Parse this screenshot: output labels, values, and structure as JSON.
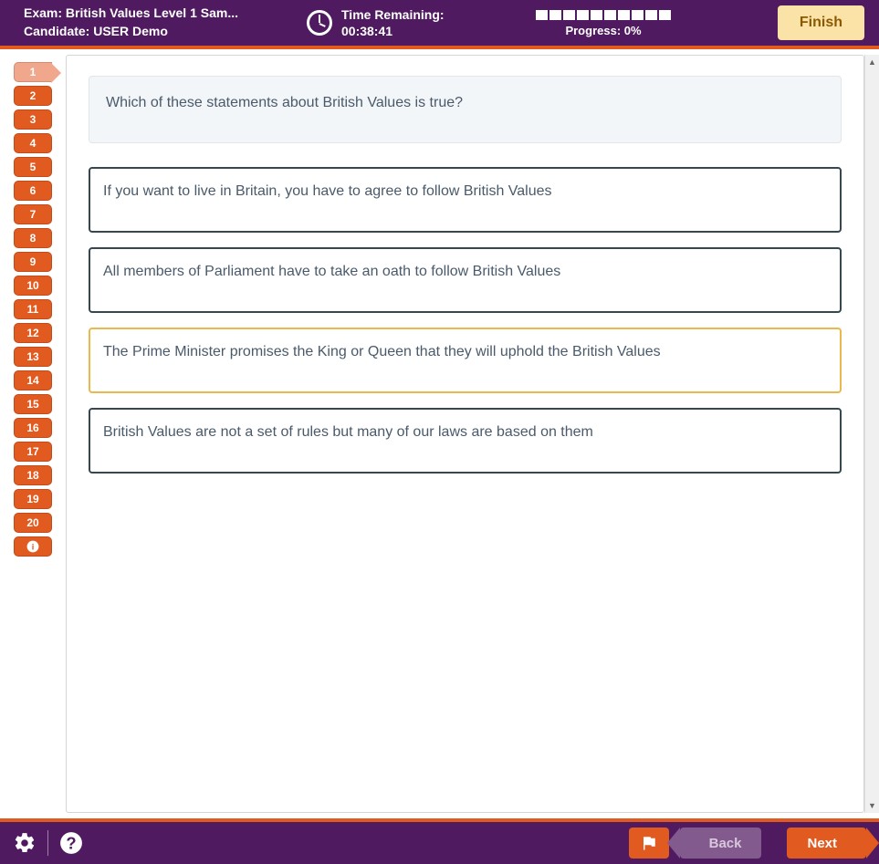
{
  "header": {
    "exam_label": "Exam: British Values Level 1 Sam...",
    "candidate_label": "Candidate: USER Demo",
    "time_title": "Time Remaining:",
    "time_value": "00:38:41",
    "progress_text": "Progress: 0%",
    "progress_segments": 10,
    "finish_label": "Finish"
  },
  "sidebar": {
    "questions": [
      "1",
      "2",
      "3",
      "4",
      "5",
      "6",
      "7",
      "8",
      "9",
      "10",
      "11",
      "12",
      "13",
      "14",
      "15",
      "16",
      "17",
      "18",
      "19",
      "20"
    ],
    "current_index": 0,
    "info_icon": "i"
  },
  "question": {
    "text": "Which of these statements about British Values is true?",
    "answers": [
      "If you want to live in Britain, you have to agree to follow British Values",
      "All members of Parliament have to take an oath to follow British Values",
      "The Prime Minister promises the King or Queen that they will uphold the British Values",
      "British Values are not a set of rules but many of our laws are based on them"
    ],
    "selected_index": 2
  },
  "footer": {
    "back_label": "Back",
    "next_label": "Next"
  }
}
